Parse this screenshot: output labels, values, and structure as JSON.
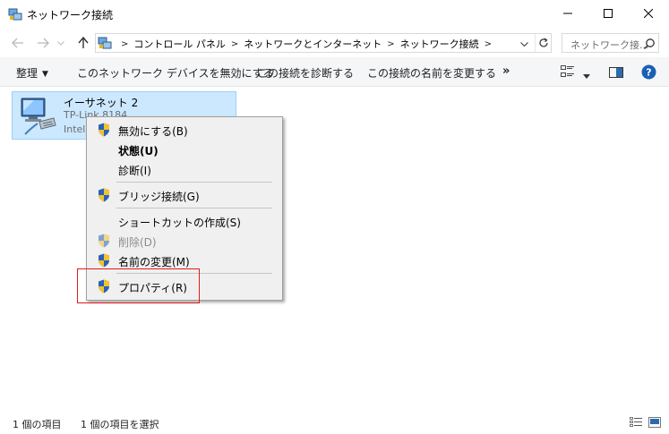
{
  "window": {
    "title": "ネットワーク接続",
    "minimize_label": "minimize-icon",
    "maximize_label": "maximize-icon",
    "close_label": "close-icon"
  },
  "address": {
    "crumbs": [
      "コントロール パネル",
      "ネットワークとインターネット",
      "ネットワーク接続"
    ],
    "search_placeholder": "ネットワーク接..."
  },
  "commands": {
    "organize": "整理",
    "disable": "このネットワーク デバイスを無効にする",
    "diagnose": "この接続を診断する",
    "rename": "この接続の名前を変更する",
    "more": "»"
  },
  "item": {
    "name": "イーサネット 2",
    "sub1": "TP-Link 8184",
    "sub2": "Intel"
  },
  "context_menu": {
    "items": [
      {
        "label": "無効にする(B)",
        "shield": true,
        "bold": false,
        "disabled": false
      },
      {
        "label": "状態(U)",
        "shield": false,
        "bold": true,
        "disabled": false
      },
      {
        "label": "診断(I)",
        "shield": false,
        "bold": false,
        "disabled": false
      },
      {
        "label": "ブリッジ接続(G)",
        "shield": true,
        "bold": false,
        "disabled": false
      },
      {
        "label": "ショートカットの作成(S)",
        "shield": false,
        "bold": false,
        "disabled": false
      },
      {
        "label": "削除(D)",
        "shield": true,
        "bold": false,
        "disabled": true
      },
      {
        "label": "名前の変更(M)",
        "shield": true,
        "bold": false,
        "disabled": false
      },
      {
        "label": "プロパティ(R)",
        "shield": true,
        "bold": false,
        "disabled": false
      }
    ]
  },
  "status": {
    "count": "1 個の項目",
    "selected": "1 個の項目を選択"
  },
  "colors": {
    "selection_bg": "#cce8ff",
    "selection_border": "#99d1ff",
    "highlight_box": "#e01c1c",
    "help_blue": "#1a5fb4"
  }
}
